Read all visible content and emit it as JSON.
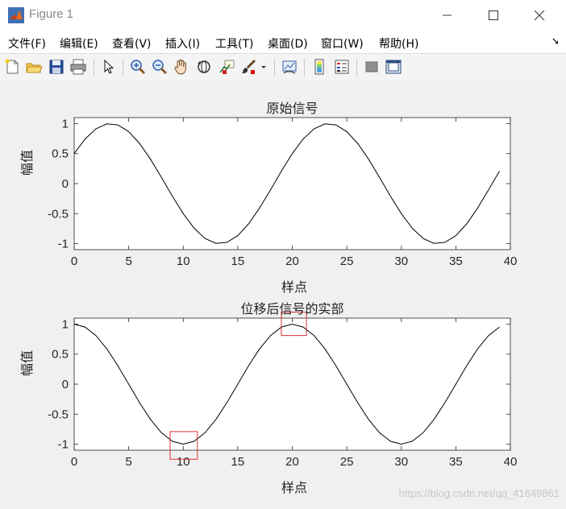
{
  "window": {
    "title": "Figure 1",
    "controls": [
      "minimize-icon",
      "maximize-icon",
      "close-icon"
    ]
  },
  "menubar": {
    "items": [
      "文件(F)",
      "编辑(E)",
      "查看(V)",
      "插入(I)",
      "工具(T)",
      "桌面(D)",
      "窗口(W)",
      "帮助(H)"
    ],
    "overflow_icon": "arrow-expand-icon"
  },
  "toolbar": {
    "icons": [
      "new-figure-icon",
      "open-file-icon",
      "save-icon",
      "print-icon",
      "pointer-icon",
      "zoom-in-icon",
      "zoom-out-icon",
      "pan-hand-icon",
      "rotate-3d-icon",
      "data-cursor-icon",
      "brush-icon",
      "brush-dropdown-icon",
      "link-plot-icon",
      "colorbar-icon",
      "legend-icon",
      "hide-plot-tools-icon",
      "show-plot-tools-icon"
    ]
  },
  "chart_data": [
    {
      "type": "line",
      "title": "原始信号",
      "xlabel": "样点",
      "ylabel": "幅值",
      "xlim": [
        0,
        40
      ],
      "ylim": [
        -1.1,
        1.1
      ],
      "xticks": [
        "0",
        "5",
        "10",
        "15",
        "20",
        "25",
        "30",
        "35",
        "40"
      ],
      "yticks": [
        "1",
        "0.5",
        "0",
        "-0.5",
        "-1"
      ],
      "grid": false,
      "series": [
        {
          "color": "#000000",
          "x": [
            0,
            1,
            2,
            3,
            4,
            5,
            6,
            7,
            8,
            9,
            10,
            11,
            12,
            13,
            14,
            15,
            16,
            17,
            18,
            19,
            20,
            21,
            22,
            23,
            24,
            25,
            26,
            27,
            28,
            29,
            30,
            31,
            32,
            33,
            34,
            35,
            36,
            37,
            38,
            39
          ],
          "y": [
            0.5,
            0.743,
            0.914,
            0.995,
            0.978,
            0.866,
            0.669,
            0.407,
            0.105,
            -0.208,
            -0.5,
            -0.743,
            -0.914,
            -0.995,
            -0.978,
            -0.866,
            -0.669,
            -0.407,
            -0.105,
            0.208,
            0.5,
            0.743,
            0.914,
            0.995,
            0.978,
            0.866,
            0.669,
            0.407,
            0.105,
            -0.208,
            -0.5,
            -0.743,
            -0.914,
            -0.995,
            -0.978,
            -0.866,
            -0.669,
            -0.407,
            -0.105,
            0.208
          ]
        }
      ]
    },
    {
      "type": "line",
      "title": "位移后信号的实部",
      "xlabel": "样点",
      "ylabel": "幅值",
      "xlim": [
        0,
        40
      ],
      "ylim": [
        -1.1,
        1.1
      ],
      "xticks": [
        "0",
        "5",
        "10",
        "15",
        "20",
        "25",
        "30",
        "35",
        "40"
      ],
      "yticks": [
        "1",
        "0.5",
        "0",
        "-0.5",
        "-1"
      ],
      "grid": false,
      "series": [
        {
          "color": "#000000",
          "x": [
            0,
            1,
            2,
            3,
            4,
            5,
            6,
            7,
            8,
            9,
            10,
            11,
            12,
            13,
            14,
            15,
            16,
            17,
            18,
            19,
            20,
            21,
            22,
            23,
            24,
            25,
            26,
            27,
            28,
            29,
            30,
            31,
            32,
            33,
            34,
            35,
            36,
            37,
            38,
            39
          ],
          "y": [
            1,
            0.951,
            0.809,
            0.588,
            0.309,
            0,
            -0.309,
            -0.588,
            -0.809,
            -0.951,
            -1,
            -0.951,
            -0.809,
            -0.588,
            -0.309,
            0,
            0.309,
            0.588,
            0.809,
            0.951,
            1,
            0.951,
            0.809,
            0.588,
            0.309,
            0,
            -0.309,
            -0.588,
            -0.809,
            -0.951,
            -1,
            -0.951,
            -0.809,
            -0.588,
            -0.309,
            0,
            0.309,
            0.588,
            0.809,
            0.951
          ]
        }
      ],
      "annotations": [
        {
          "shape": "rectangle",
          "color": "#e03030",
          "x_range": [
            8.8,
            11.3
          ],
          "y_range": [
            -1.25,
            -0.79
          ]
        },
        {
          "shape": "rectangle",
          "color": "#e03030",
          "x_range": [
            19.0,
            21.3
          ],
          "y_range": [
            0.81,
            1.2
          ]
        }
      ]
    }
  ],
  "watermark": "https://blog.csdn.net/qq_41649861"
}
